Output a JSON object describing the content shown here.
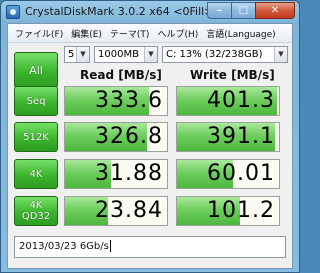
{
  "window": {
    "title": "CrystalDiskMark 3.0.2 x64 <0Fill>",
    "buttons": {
      "minimize": "–",
      "maximize": "□",
      "close": "✕"
    }
  },
  "menu": [
    "ファイル(F)",
    "編集(E)",
    "テーマ(T)",
    "ヘルプ(H)",
    "言語(Language)"
  ],
  "controls": {
    "all_label": "All",
    "test_count": "5",
    "test_size": "1000MB",
    "drive": "C: 13% (32/238GB)"
  },
  "headers": {
    "read": "Read [MB/s]",
    "write": "Write [MB/s]"
  },
  "tests": [
    {
      "label_line1": "Seq",
      "label_line2": "",
      "read": "333.6",
      "write": "401.3",
      "read_level": 0.82,
      "write_level": 0.98
    },
    {
      "label_line1": "512K",
      "label_line2": "",
      "read": "326.8",
      "write": "391.1",
      "read_level": 0.8,
      "write_level": 0.96
    },
    {
      "label_line1": "4K",
      "label_line2": "",
      "read": "31.88",
      "write": "60.01",
      "read_level": 0.45,
      "write_level": 0.55
    },
    {
      "label_line1": "4K",
      "label_line2": "QD32",
      "read": "23.84",
      "write": "101.2",
      "read_level": 0.42,
      "write_level": 0.62
    }
  ],
  "comment": "2013/03/23 6Gb/s",
  "colors": {
    "accent_green": "#3cb52d",
    "bar_green": "#6fce5f"
  }
}
